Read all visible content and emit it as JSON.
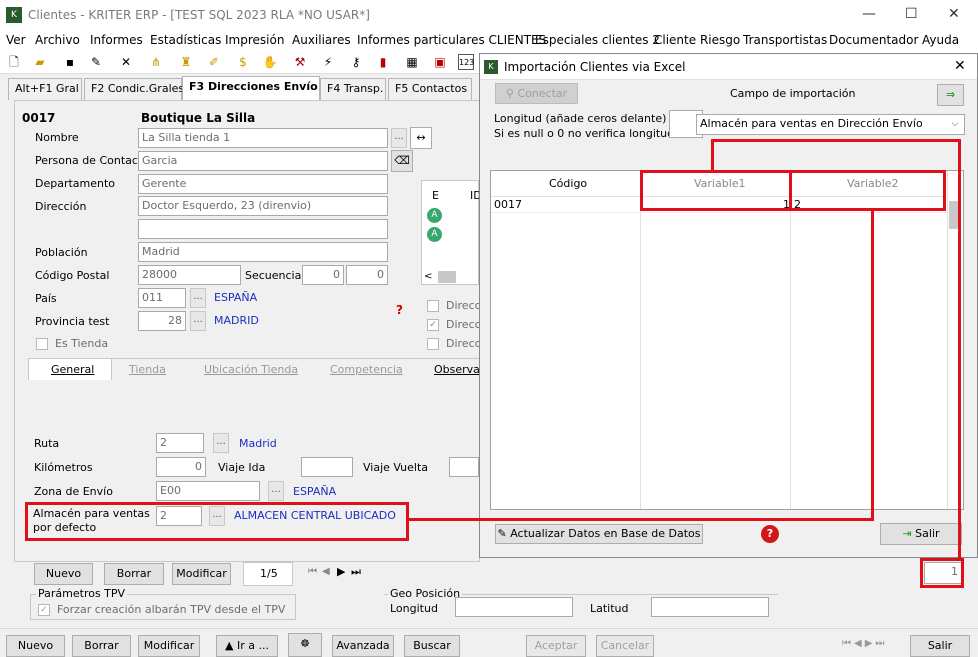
{
  "window": {
    "title": "Clientes - KRITER ERP - [TEST SQL 2023 RLA *NO USAR*]"
  },
  "menu": [
    "Ver",
    "Archivo",
    "Informes",
    "Estadísticas",
    "Impresión",
    "Auxiliares",
    "Informes particulares CLIENTES",
    "Especiales clientes 2",
    "Cliente Riesgo",
    "Transportistas",
    "Documentador",
    "Ayuda"
  ],
  "tabs": [
    "Alt+F1 Gral",
    "F2 Condic.Grales",
    "F3 Direcciones Envío",
    "F4 Transp.",
    "F5 Contactos"
  ],
  "record": {
    "code": "0017",
    "name_header": "Boutique La Silla"
  },
  "form": {
    "nombre_label": "Nombre",
    "nombre": "La Silla tienda 1",
    "contacto_label": "Persona de Contacto",
    "contacto": "Garcia",
    "depto_label": "Departamento",
    "depto": "Gerente",
    "direccion_label": "Dirección",
    "direccion": "Doctor Esquerdo, 23 (direnvio)",
    "poblacion_label": "Población",
    "poblacion": "Madrid",
    "cp_label": "Código Postal",
    "cp": "28000",
    "secuencia_label": "Secuencia",
    "sec1": "0",
    "sec2": "0",
    "pais_label": "País",
    "pais_code": "011",
    "pais_name": "ESPAÑA",
    "provincia_label": "Provincia test",
    "provincia_code": "28",
    "provincia_name": "MADRID",
    "es_tienda": "Es Tienda",
    "subtabs": [
      "General",
      "Tienda",
      "Ubicación Tienda",
      "Competencia",
      "Observac"
    ],
    "ruta_label": "Ruta",
    "ruta": "2",
    "ruta_name": "Madrid",
    "km_label": "Kilómetros",
    "km": "0",
    "viaje_ida": "Viaje Ida",
    "viaje_vuelta": "Viaje Vuelta",
    "zona_label": "Zona de Envío",
    "zona": "E00",
    "zona_name": "ESPAÑA",
    "almacen_label": "Almacén para ventas por defecto",
    "almacen": "2",
    "almacen_name": "ALMACEN CENTRAL UBICADO",
    "nuevo": "Nuevo",
    "borrar": "Borrar",
    "modificar": "Modificar",
    "pager": "1/5",
    "tpv_title": "Parámetros TPV",
    "tpv_check": "Forzar creación albarán TPV desde el TPV",
    "geo_title": "Geo Posición",
    "longitud": "Longitud",
    "latitud": "Latitud"
  },
  "side_grid": {
    "col_e": "E",
    "col_id": "ID",
    "badge": "A",
    "direcc": "Direcci"
  },
  "dialog": {
    "title": "Importación Clientes via Excel",
    "conectar": "Conectar",
    "campo_label": "Campo de importación",
    "longitud_label": "Longitud (añade ceros delante)",
    "longitud_note": "Si es null o 0 no verifica longitud",
    "campo_value": "Almacén para ventas en Dirección Envío",
    "columns": [
      "Código",
      "Variable1",
      "Variable2"
    ],
    "rows": [
      [
        "0017",
        "1",
        "2"
      ]
    ],
    "actualizar": "Actualizar Datos en Base de Datos",
    "salir": "Salir"
  },
  "counter": "1",
  "bottom": [
    "Nuevo",
    "Borrar",
    "Modificar",
    "Ir a ...",
    "Avanzada",
    "Buscar",
    "Aceptar",
    "Cancelar",
    "Salir"
  ]
}
